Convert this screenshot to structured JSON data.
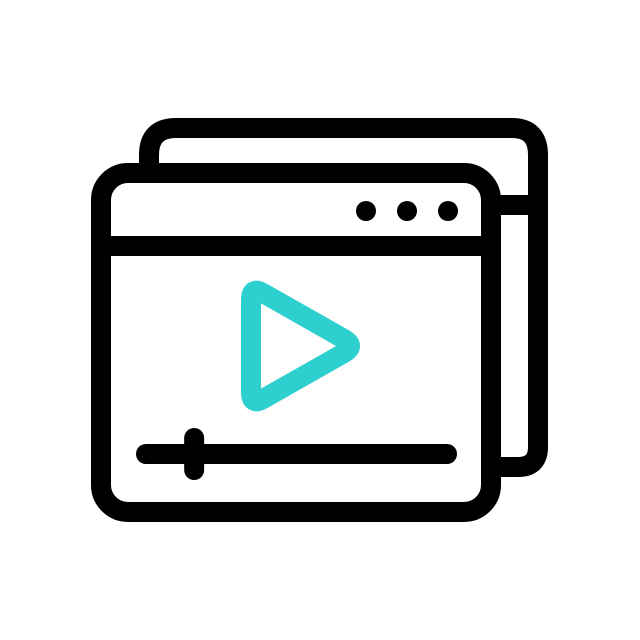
{
  "icon": {
    "name": "video-player-windows-icon",
    "stroke_color": "#000000",
    "accent_color": "#2ecfcf",
    "background_color": "#ffffff"
  },
  "video": {
    "progress": 0.16
  }
}
